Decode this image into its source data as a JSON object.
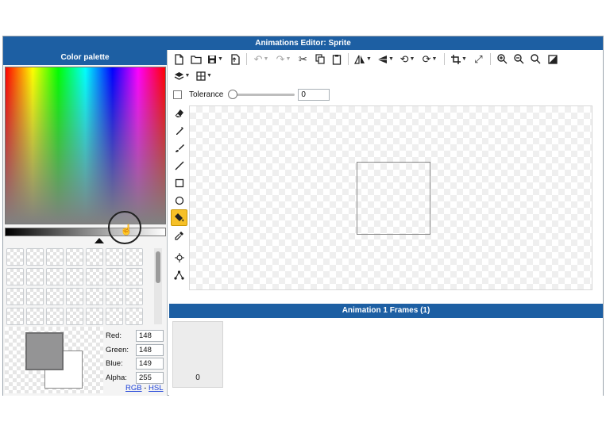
{
  "window": {
    "title": "Animations Editor: Sprite"
  },
  "palette": {
    "title": "Color palette",
    "primary_color": "#949495",
    "secondary_color": "#ffffff",
    "fields": [
      {
        "label": "Red:",
        "value": "148"
      },
      {
        "label": "Green:",
        "value": "148"
      },
      {
        "label": "Blue:",
        "value": "149"
      },
      {
        "label": "Alpha:",
        "value": "255"
      }
    ],
    "mode_links": {
      "rgb": "RGB",
      "separator": "-",
      "hsl": "HSL"
    }
  },
  "toolbar": {
    "row1_icons": [
      "new-file-icon",
      "open-folder-icon",
      "save-icon",
      "export-icon",
      "undo-icon",
      "redo-icon",
      "cut-icon",
      "copy-icon",
      "paste-icon",
      "flip-horizontal-icon",
      "flip-vertical-icon",
      "rotate-left-icon",
      "rotate-right-icon",
      "crop-icon",
      "resize-icon",
      "zoom-in-icon",
      "zoom-out-icon",
      "zoom-icon",
      "invert-icon"
    ],
    "row2_icons": [
      "layers-icon",
      "grid-icon"
    ]
  },
  "tool_options": {
    "tolerance_label": "Tolerance",
    "tolerance_value": "0",
    "tolerance_level": 0
  },
  "tools": [
    "eraser-icon",
    "pen-icon",
    "brush-icon",
    "line-icon",
    "rectangle-icon",
    "ellipse-icon",
    "fill-bucket-icon",
    "eyedropper-icon",
    "move-origin-icon",
    "bone-icon"
  ],
  "active_tool": "fill-bucket-icon",
  "frames": {
    "title": "Animation 1 Frames (1)",
    "items": [
      {
        "label": "0"
      }
    ]
  },
  "colors": {
    "header_blue": "#1d5fa3",
    "active_tool_yellow": "#f6c027",
    "link_blue": "#1a3fd8"
  }
}
